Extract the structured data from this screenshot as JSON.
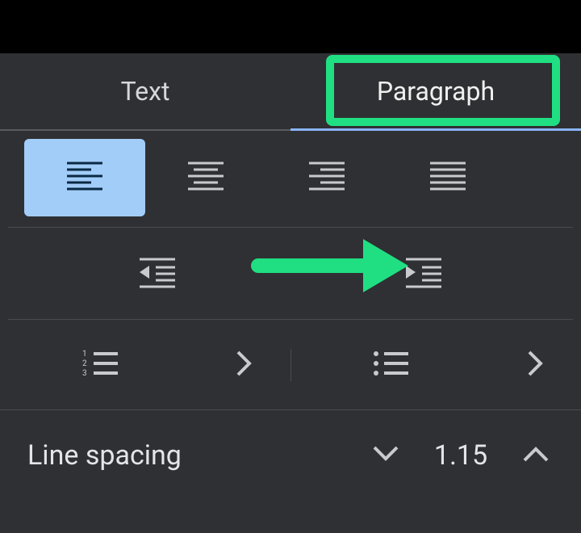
{
  "tabs": {
    "text": "Text",
    "paragraph": "Paragraph",
    "active": "paragraph"
  },
  "alignment": {
    "selected": "left",
    "options": [
      "left",
      "center",
      "right",
      "justify"
    ]
  },
  "indent": {
    "decrease": "decrease-indent",
    "increase": "increase-indent"
  },
  "lists": {
    "numbered": "numbered-list",
    "bulleted": "bulleted-list"
  },
  "line_spacing": {
    "label": "Line spacing",
    "value": "1.15"
  },
  "annotation": {
    "highlight_tab": "paragraph",
    "arrow_target": "increase-indent",
    "color": "#1fdf82"
  }
}
